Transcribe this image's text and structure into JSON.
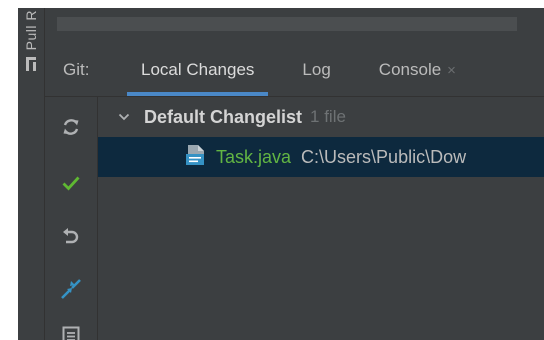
{
  "side_tab": {
    "label": "Pull R",
    "icon": "pull-request-icon"
  },
  "tabs": {
    "prefix": "Git:",
    "items": [
      {
        "label": "Local Changes",
        "active": true
      },
      {
        "label": "Log",
        "active": false
      },
      {
        "label": "Console",
        "active": false,
        "closable": true
      }
    ],
    "close_glyph": "×"
  },
  "toolbar": {
    "icons": [
      "refresh-icon",
      "commit-check-icon",
      "rollback-icon",
      "shelve-icon",
      "details-icon"
    ]
  },
  "changes": {
    "changelist_name": "Default Changelist",
    "changelist_count": "1 file",
    "files": [
      {
        "name": "Task.java",
        "path": "C:\\Users\\Public\\Dow"
      }
    ]
  },
  "colors": {
    "background": "#3c3f41",
    "selection": "#0d293e",
    "modified_file": "#62b543",
    "active_tab_underline": "#4a88c7"
  }
}
